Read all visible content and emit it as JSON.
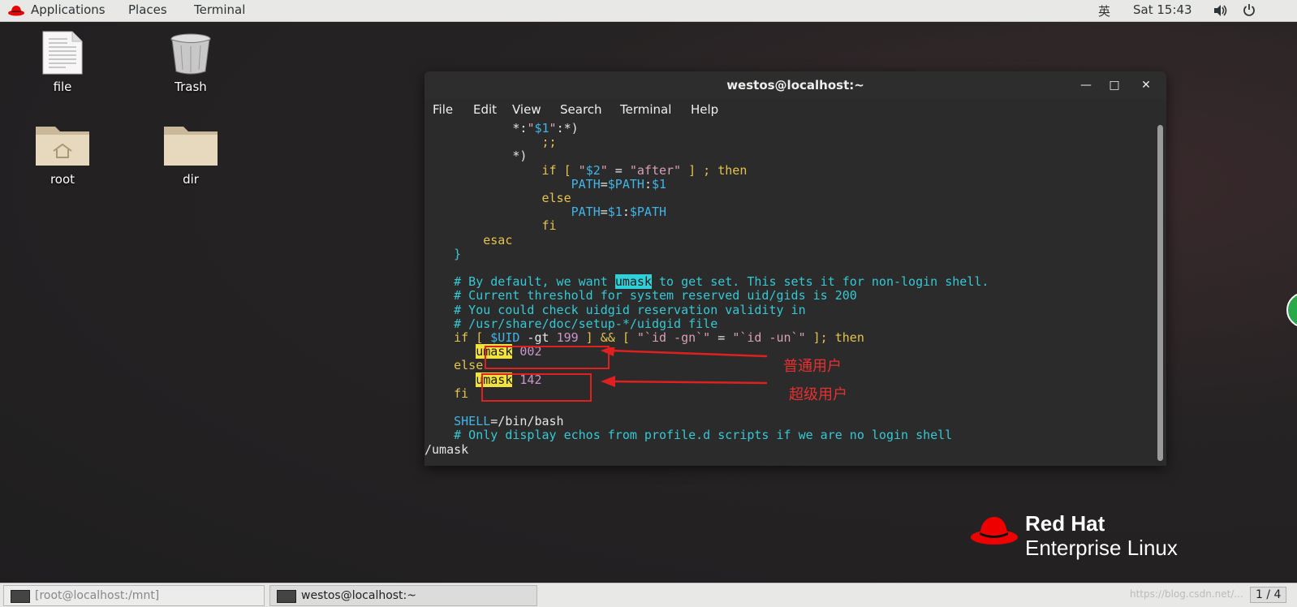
{
  "topbar": {
    "applications": "Applications",
    "places": "Places",
    "terminal": "Terminal",
    "input_method": "英",
    "clock": "Sat 15:43"
  },
  "desktop": {
    "icons": [
      {
        "label": "file"
      },
      {
        "label": "Trash"
      },
      {
        "label": "root"
      },
      {
        "label": "dir"
      }
    ]
  },
  "window": {
    "title": "westos@localhost:~",
    "menu": [
      "File",
      "Edit",
      "View",
      "Search",
      "Terminal",
      "Help"
    ]
  },
  "terminal": {
    "lines": [
      {
        "indent": "            ",
        "parts": [
          {
            "t": "*:",
            "c": "c-white"
          },
          {
            "t": "\"",
            "c": "c-str"
          },
          {
            "t": "$1",
            "c": "c-var"
          },
          {
            "t": "\"",
            "c": "c-str"
          },
          {
            "t": ":*)",
            "c": "c-white"
          }
        ]
      },
      {
        "indent": "                ",
        "parts": [
          {
            "t": ";;",
            "c": "c-yel"
          }
        ]
      },
      {
        "indent": "            ",
        "parts": [
          {
            "t": "*)",
            "c": "c-white"
          }
        ]
      },
      {
        "indent": "                ",
        "parts": [
          {
            "t": "if [ ",
            "c": "c-yel"
          },
          {
            "t": "\"",
            "c": "c-str"
          },
          {
            "t": "$2",
            "c": "c-var"
          },
          {
            "t": "\"",
            "c": "c-str"
          },
          {
            "t": " = ",
            "c": "c-white"
          },
          {
            "t": "\"after\"",
            "c": "c-str"
          },
          {
            "t": " ] ; then",
            "c": "c-yel"
          }
        ]
      },
      {
        "indent": "                    ",
        "parts": [
          {
            "t": "PATH",
            "c": "c-var"
          },
          {
            "t": "=",
            "c": "c-white"
          },
          {
            "t": "$PATH",
            "c": "c-var"
          },
          {
            "t": ":",
            "c": "c-white"
          },
          {
            "t": "$1",
            "c": "c-var"
          }
        ]
      },
      {
        "indent": "                ",
        "parts": [
          {
            "t": "else",
            "c": "c-yel"
          }
        ]
      },
      {
        "indent": "                    ",
        "parts": [
          {
            "t": "PATH",
            "c": "c-var"
          },
          {
            "t": "=",
            "c": "c-white"
          },
          {
            "t": "$1",
            "c": "c-var"
          },
          {
            "t": ":",
            "c": "c-white"
          },
          {
            "t": "$PATH",
            "c": "c-var"
          }
        ]
      },
      {
        "indent": "                ",
        "parts": [
          {
            "t": "fi",
            "c": "c-yel"
          }
        ]
      },
      {
        "indent": "        ",
        "parts": [
          {
            "t": "esac",
            "c": "c-yel"
          }
        ]
      },
      {
        "indent": "    ",
        "parts": [
          {
            "t": "}",
            "c": "c-cyan"
          }
        ]
      },
      {
        "indent": "",
        "parts": []
      },
      {
        "indent": "    ",
        "parts": [
          {
            "t": "# By default, we want ",
            "c": "c-cyan"
          },
          {
            "t": "umask",
            "c": "hl-cyan"
          },
          {
            "t": " to get set. This sets it for non-login shell.",
            "c": "c-cyan"
          }
        ]
      },
      {
        "indent": "    ",
        "parts": [
          {
            "t": "# Current threshold for system reserved uid/gids is 200",
            "c": "c-cyan"
          }
        ]
      },
      {
        "indent": "    ",
        "parts": [
          {
            "t": "# You could check uidgid reservation validity in",
            "c": "c-cyan"
          }
        ]
      },
      {
        "indent": "    ",
        "parts": [
          {
            "t": "# /usr/share/doc/setup-*/uidgid file",
            "c": "c-cyan"
          }
        ]
      },
      {
        "indent": "    ",
        "parts": [
          {
            "t": "if [ ",
            "c": "c-yel"
          },
          {
            "t": "$UID",
            "c": "c-var"
          },
          {
            "t": " -gt ",
            "c": "c-white"
          },
          {
            "t": "199",
            "c": "c-num"
          },
          {
            "t": " ] && [ ",
            "c": "c-yel"
          },
          {
            "t": "\"`id -gn`\"",
            "c": "c-str"
          },
          {
            "t": " = ",
            "c": "c-white"
          },
          {
            "t": "\"`id -un`\"",
            "c": "c-str"
          },
          {
            "t": " ]; then",
            "c": "c-yel"
          }
        ]
      },
      {
        "indent": "       ",
        "parts": [
          {
            "t": "umask",
            "c": "hl-yel"
          },
          {
            "t": " ",
            "c": "c-white"
          },
          {
            "t": "002",
            "c": "c-num"
          }
        ]
      },
      {
        "indent": "    ",
        "parts": [
          {
            "t": "else",
            "c": "c-yel"
          }
        ]
      },
      {
        "indent": "       ",
        "parts": [
          {
            "t": "umask",
            "c": "hl-yel"
          },
          {
            "t": " ",
            "c": "c-white"
          },
          {
            "t": "142",
            "c": "c-num"
          }
        ]
      },
      {
        "indent": "    ",
        "parts": [
          {
            "t": "fi",
            "c": "c-yel"
          }
        ]
      },
      {
        "indent": "",
        "parts": []
      },
      {
        "indent": "    ",
        "parts": [
          {
            "t": "SHELL",
            "c": "c-var"
          },
          {
            "t": "=/bin/bash",
            "c": "c-white"
          }
        ]
      },
      {
        "indent": "    ",
        "parts": [
          {
            "t": "# Only display echos from profile.d scripts if we are no login shell",
            "c": "c-cyan"
          }
        ]
      },
      {
        "indent": "",
        "parts": [
          {
            "t": "/umask",
            "c": "c-white"
          }
        ]
      }
    ]
  },
  "annotations": {
    "normal_user": "普通用户",
    "super_user": "超级用户"
  },
  "logo": {
    "line1": "Red Hat",
    "line2": "Enterprise Linux"
  },
  "taskbar": {
    "task1": "[root@localhost:/mnt]",
    "task2": "westos@localhost:~",
    "watermark": "https://blog.csdn.net/...",
    "workspace": "1 / 4"
  },
  "colors": {
    "redhat_red": "#ee0000",
    "annotation_red": "#e02020"
  }
}
